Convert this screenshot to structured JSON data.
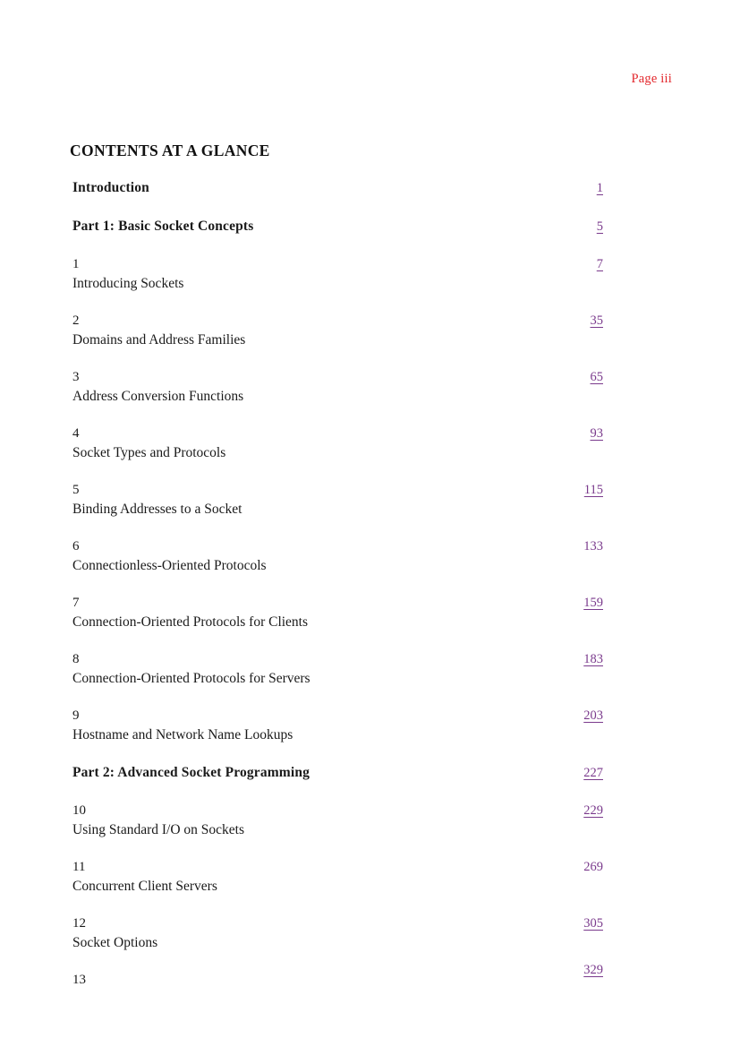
{
  "header": {
    "running_head": "Page iii",
    "running_head_color": "#e3262b"
  },
  "title": "CONTENTS AT A GLANCE",
  "colors": {
    "link": "#7a3a8c",
    "text": "#1a1a1a",
    "header": "#e3262b",
    "background": "#ffffff"
  },
  "toc": {
    "entries": [
      {
        "kind": "front-matter",
        "label": "Introduction",
        "title": "",
        "page": "1",
        "underlined": true
      },
      {
        "kind": "part",
        "label": "Part 1: Basic Socket Concepts",
        "title": "",
        "page": "5",
        "underlined": true
      },
      {
        "kind": "chapter",
        "label": "1",
        "title": "Introducing Sockets",
        "page": "7",
        "underlined": true
      },
      {
        "kind": "chapter",
        "label": "2",
        "title": "Domains and Address Families",
        "page": "35",
        "underlined": true
      },
      {
        "kind": "chapter",
        "label": "3",
        "title": "Address Conversion Functions",
        "page": "65",
        "underlined": true
      },
      {
        "kind": "chapter",
        "label": "4",
        "title": "Socket Types and Protocols",
        "page": "93",
        "underlined": true
      },
      {
        "kind": "chapter",
        "label": "5",
        "title": "Binding Addresses to a Socket",
        "page": "115",
        "underlined": true
      },
      {
        "kind": "chapter",
        "label": "6",
        "title": "Connectionless-Oriented Protocols",
        "page": "133",
        "underlined": false
      },
      {
        "kind": "chapter",
        "label": "7",
        "title": "Connection-Oriented Protocols for Clients",
        "page": "159",
        "underlined": true
      },
      {
        "kind": "chapter",
        "label": "8",
        "title": "Connection-Oriented Protocols for Servers",
        "page": "183",
        "underlined": true
      },
      {
        "kind": "chapter",
        "label": "9",
        "title": "Hostname and Network Name Lookups",
        "page": "203",
        "underlined": true
      },
      {
        "kind": "part",
        "label": "Part 2: Advanced Socket Programming",
        "title": "",
        "page": "227",
        "underlined": true
      },
      {
        "kind": "chapter",
        "label": "10",
        "title": "Using Standard I/O on Sockets",
        "page": "229",
        "underlined": true
      },
      {
        "kind": "chapter",
        "label": "11",
        "title": "Concurrent Client Servers",
        "page": "269",
        "underlined": false
      },
      {
        "kind": "chapter",
        "label": "12",
        "title": "Socket Options",
        "page": "305",
        "underlined": true
      },
      {
        "kind": "chapter",
        "label": "13",
        "title": "",
        "page": "329",
        "underlined": true,
        "page_raised": true
      }
    ]
  }
}
